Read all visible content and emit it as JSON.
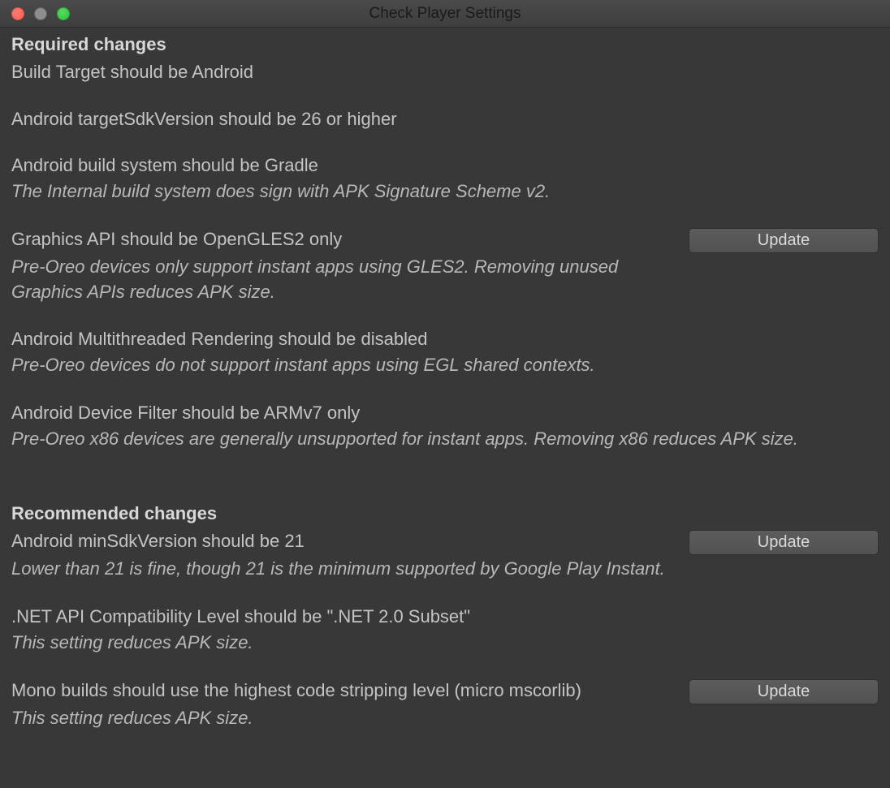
{
  "window": {
    "title": "Check Player Settings"
  },
  "buttons": {
    "update": "Update"
  },
  "sections": {
    "required": {
      "header": "Required changes",
      "items": [
        {
          "title": "Build Target should be Android",
          "desc": "",
          "hasButton": false
        },
        {
          "title": "Android targetSdkVersion should be 26 or higher",
          "desc": "",
          "hasButton": false
        },
        {
          "title": "Android build system should be Gradle",
          "desc": "The Internal build system does sign with APK Signature Scheme v2.",
          "hasButton": false
        },
        {
          "title": "Graphics API should be OpenGLES2 only",
          "desc": "Pre-Oreo devices only support instant apps using GLES2. Removing unused Graphics APIs reduces APK size.",
          "hasButton": true
        },
        {
          "title": "Android Multithreaded Rendering should be disabled",
          "desc": "Pre-Oreo devices do not support instant apps using EGL shared contexts.",
          "hasButton": false
        },
        {
          "title": "Android Device Filter should be ARMv7 only",
          "desc": "Pre-Oreo x86 devices are generally unsupported for instant apps. Removing x86 reduces APK size.",
          "hasButton": false
        }
      ]
    },
    "recommended": {
      "header": "Recommended changes",
      "items": [
        {
          "title": "Android minSdkVersion should be 21",
          "desc": "Lower than 21 is fine, though 21 is the minimum supported by Google Play Instant.",
          "hasButton": true
        },
        {
          "title": ".NET API Compatibility Level should be \".NET 2.0 Subset\"",
          "desc": "This setting reduces APK size.",
          "hasButton": false
        },
        {
          "title": "Mono builds should use the highest code stripping level (micro mscorlib)",
          "desc": "This setting reduces APK size.",
          "hasButton": true
        }
      ]
    }
  }
}
